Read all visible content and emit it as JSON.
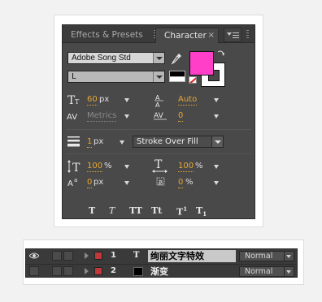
{
  "panel": {
    "tabs": [
      {
        "label": "Effects & Presets"
      },
      {
        "label": "Character"
      }
    ],
    "close_glyph": "×",
    "menu_icon": "panel-menu-icon"
  },
  "character": {
    "font_family": "Adobe Song Std",
    "font_style": "L",
    "fill_color": "#ff3fc8",
    "stroke_color": "#ffffff",
    "font_size": {
      "value": "60",
      "unit": "px"
    },
    "leading": {
      "value": "Auto"
    },
    "kerning": {
      "value": "Metrics"
    },
    "tracking": {
      "value": "0"
    },
    "stroke_width": {
      "value": "1",
      "unit": "px"
    },
    "stroke_mode": "Stroke Over Fill",
    "vertical_scale": {
      "value": "100",
      "unit": "%"
    },
    "horizontal_scale": {
      "value": "100",
      "unit": "%"
    },
    "baseline_shift": {
      "value": "0",
      "unit": "px"
    },
    "tsume": {
      "value": "0",
      "unit": "%"
    },
    "style_buttons": [
      {
        "label": "T",
        "name": "faux-bold"
      },
      {
        "label": "T",
        "name": "faux-italic"
      },
      {
        "label": "TT",
        "name": "all-caps"
      },
      {
        "label": "Tt",
        "name": "small-caps"
      },
      {
        "label": "T",
        "sup": "1",
        "name": "superscript"
      },
      {
        "label": "T",
        "sub": "1",
        "name": "subscript"
      }
    ]
  },
  "timeline": {
    "layers": [
      {
        "number": "1",
        "type": "T",
        "name": "绚丽文字特效",
        "mode": "Normal",
        "label_color": "#c0383a",
        "selected": true
      },
      {
        "number": "2",
        "type": "",
        "name": "渐变",
        "mode": "Normal",
        "label_color": "#c0383a",
        "selected": false
      }
    ]
  }
}
